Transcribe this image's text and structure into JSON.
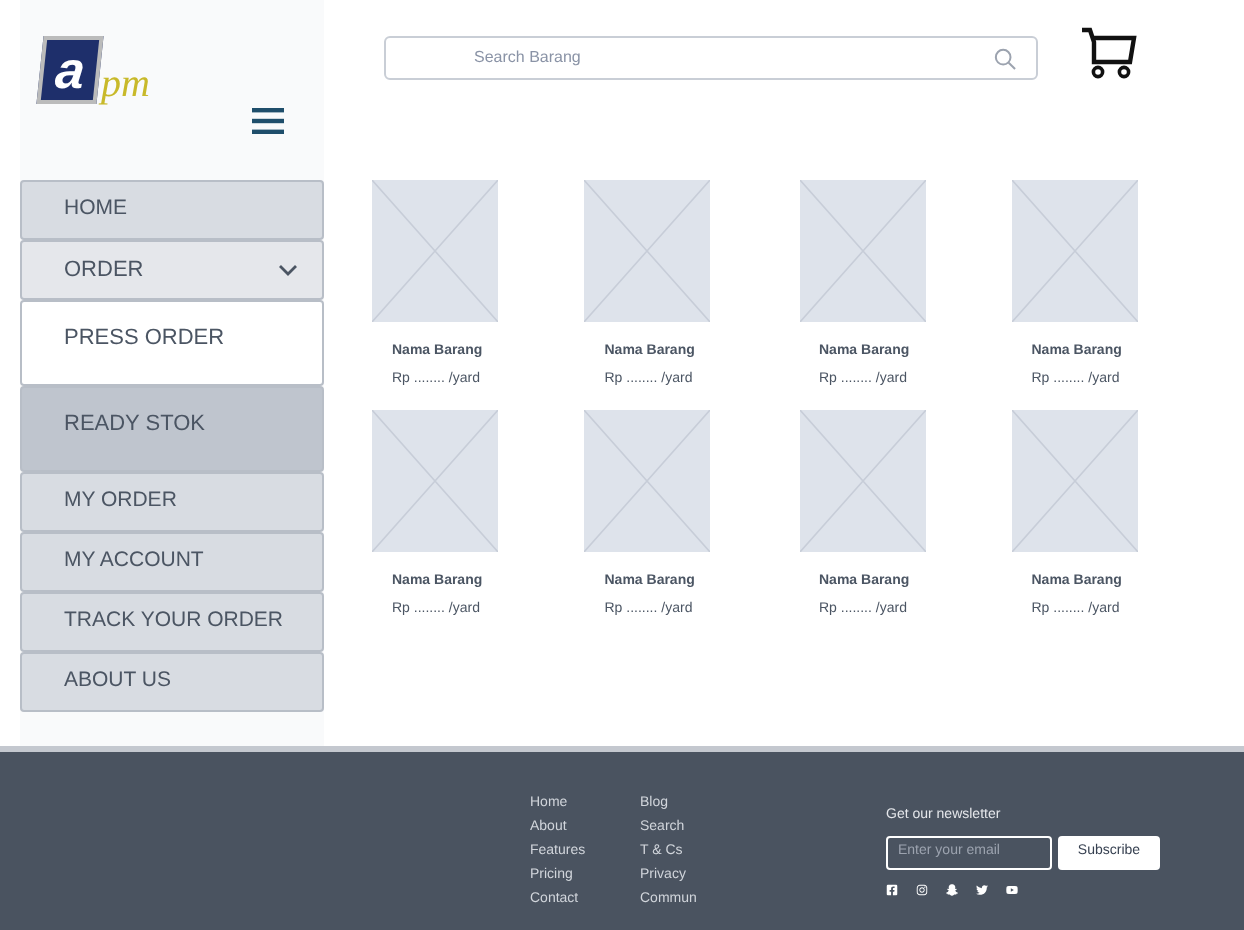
{
  "logo": {
    "mark": "a",
    "text": "pm"
  },
  "search": {
    "placeholder": "Search Barang"
  },
  "menu": [
    {
      "label": "HOME",
      "kind": "link"
    },
    {
      "label": "ORDER",
      "kind": "group",
      "expanded": true,
      "children": [
        {
          "label": "PRESS ORDER",
          "selected": false
        },
        {
          "label": "READY STOK",
          "selected": true
        }
      ]
    },
    {
      "label": "MY ORDER",
      "kind": "link"
    },
    {
      "label": "MY ACCOUNT",
      "kind": "link"
    },
    {
      "label": "TRACK YOUR ORDER",
      "kind": "link"
    },
    {
      "label": "ABOUT US",
      "kind": "link"
    }
  ],
  "products": [
    {
      "name": "Nama Barang",
      "price": "Rp ........ /yard"
    },
    {
      "name": "Nama Barang",
      "price": "Rp ........ /yard"
    },
    {
      "name": "Nama Barang",
      "price": "Rp ........ /yard"
    },
    {
      "name": "Nama Barang",
      "price": "Rp ........ /yard"
    },
    {
      "name": "Nama Barang",
      "price": "Rp ........ /yard"
    },
    {
      "name": "Nama Barang",
      "price": "Rp ........ /yard"
    },
    {
      "name": "Nama Barang",
      "price": "Rp ........ /yard"
    },
    {
      "name": "Nama Barang",
      "price": "Rp ........ /yard"
    }
  ],
  "footer": {
    "link_columns": [
      [
        "Home",
        "About",
        "Features",
        "Pricing",
        "Contact"
      ],
      [
        "Blog",
        "Search",
        "T & Cs",
        "Privacy",
        "Commun"
      ]
    ],
    "newsletter": {
      "heading": "Get our newsletter",
      "placeholder": "Enter your email",
      "button": "Subscribe"
    },
    "social": [
      {
        "kind": "facebook"
      },
      {
        "kind": "instagram"
      },
      {
        "kind": "snapchat"
      },
      {
        "kind": "twitter"
      },
      {
        "kind": "youtube"
      }
    ]
  }
}
